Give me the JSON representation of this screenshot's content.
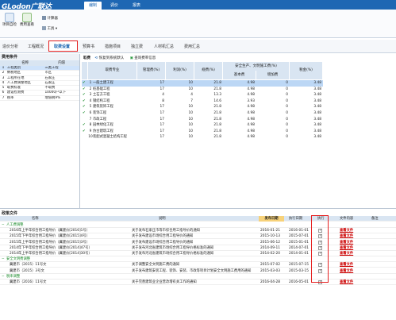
{
  "app": {
    "logo": "GLodon广联达",
    "top_tabs": [
      "编制",
      "调价",
      "报表"
    ],
    "active_top_tab": "编制"
  },
  "ribbon": {
    "buttons": [
      "项目自检",
      "费用查看"
    ],
    "calc_label": "计算器",
    "tools_label": "工具"
  },
  "nav_tabs": [
    "造价分析",
    "工程概况",
    "取费设置",
    "预算书",
    "措施项目",
    "独立费",
    "人材机汇总",
    "费用汇总"
  ],
  "active_nav_tab": "取费设置",
  "left_panel": {
    "title": "费用条件",
    "headers": [
      "名称",
      "内容"
    ],
    "rows": [
      {
        "num": "1",
        "name": "工程类别",
        "value": "三类工程"
      },
      {
        "num": "2",
        "name": "纳税地区",
        "value": "市区"
      },
      {
        "num": "3",
        "name": "工程所在地",
        "value": "石家庄"
      },
      {
        "num": "4",
        "name": "人工费调整地区",
        "value": "石家庄"
      },
      {
        "num": "5",
        "name": "取费标准",
        "value": "不取费"
      },
      {
        "num": "6",
        "name": "建设检测费",
        "value": "10000户以下"
      },
      {
        "num": "7",
        "name": "税率",
        "value": "增值税9%"
      }
    ]
  },
  "main": {
    "toolbar": [
      "取费",
      "恢复到系统默认",
      "查询费率信息"
    ],
    "headers": {
      "col_major": "取费专业",
      "col_mgmt": "管理费(%)",
      "col_profit": "利润(%)",
      "col_fee": "规费(%)",
      "col_safety": "安全生产、文明施工费(%)",
      "col_safety_base": "基本费",
      "col_safety_add": "增加费",
      "col_tax": "税金(%)"
    },
    "rows": [
      {
        "num": "1",
        "name": "一般土建工程",
        "mgmt": "17",
        "profit": "10",
        "fee": "21.8",
        "base": "4.98",
        "add": "0",
        "tax": "3.48",
        "checked": true
      },
      {
        "num": "2",
        "name": "桩基础工程",
        "mgmt": "17",
        "profit": "10",
        "fee": "21.8",
        "base": "4.98",
        "add": "0",
        "tax": "3.48",
        "checked": true
      },
      {
        "num": "3",
        "name": "土石方工程",
        "mgmt": "4",
        "profit": "4",
        "fee": "13.3",
        "base": "4.98",
        "add": "0",
        "tax": "3.48",
        "checked": true
      },
      {
        "num": "4",
        "name": "钢结构工程",
        "mgmt": "8",
        "profit": "7",
        "fee": "14.6",
        "base": "3.93",
        "add": "0",
        "tax": "3.48",
        "checked": true
      },
      {
        "num": "5",
        "name": "建筑装饰工程",
        "mgmt": "17",
        "profit": "10",
        "fee": "21.8",
        "base": "4.98",
        "add": "0",
        "tax": "3.48",
        "checked": true
      },
      {
        "num": "6",
        "name": "装饰工程",
        "mgmt": "17",
        "profit": "10",
        "fee": "21.8",
        "base": "4.98",
        "add": "0",
        "tax": "3.48",
        "checked": true
      },
      {
        "num": "7",
        "name": "市政工程",
        "mgmt": "17",
        "profit": "10",
        "fee": "21.8",
        "base": "4.98",
        "add": "0",
        "tax": "3.48",
        "checked": false
      },
      {
        "num": "8",
        "name": "园林绿化工程",
        "mgmt": "17",
        "profit": "10",
        "fee": "21.8",
        "base": "4.98",
        "add": "0",
        "tax": "3.48",
        "checked": true
      },
      {
        "num": "9",
        "name": "仿古建筑工程",
        "mgmt": "17",
        "profit": "10",
        "fee": "21.8",
        "base": "4.98",
        "add": "0",
        "tax": "3.48",
        "checked": true
      },
      {
        "num": "10",
        "name": "装配式混凝土结构工程",
        "mgmt": "17",
        "profit": "10",
        "fee": "21.8",
        "base": "4.98",
        "add": "0",
        "tax": "3.48",
        "checked": false
      }
    ]
  },
  "bottom": {
    "title": "政策文件",
    "headers": {
      "col_name": "名称",
      "col_desc": "说明",
      "col_date": "发布日期",
      "col_exec": "执行日期",
      "col_apply": "执行",
      "col_file": "文件内容",
      "col_note": "备注"
    },
    "rows": [
      {
        "type": "group",
        "name": "人工费调整"
      },
      {
        "type": "item",
        "name": "2016年上半年综合用工指导价（冀建价[2016]1号）",
        "desc": "关于发布石家庄市等市综合用工指导价的通知",
        "date": "2016-01-21",
        "exec": "2016-01-01",
        "checked": true,
        "link": "查看文件"
      },
      {
        "type": "item",
        "name": "2015年下半年综合用工指导价（冀建价[2015]4号）",
        "desc": "关于发布建设市场综合用工指导价的通知",
        "date": "2015-10-13",
        "exec": "2015-07-01",
        "checked": true,
        "link": "查看文件"
      },
      {
        "type": "item",
        "name": "2015年上半年综合用工指导价（冀建价[2015]3号）",
        "desc": "关于发布建设市场综合用工指导价的通知",
        "date": "2015-06-12",
        "exec": "2015-01-01",
        "checked": true,
        "link": "查看文件"
      },
      {
        "type": "item",
        "name": "2014年下半年综合用工指导价（冀建价[2014]47号）",
        "desc": "关于发布河北省建筑市场综合用工指导价格标准的通知",
        "date": "2014-09-11",
        "exec": "2014-07-01",
        "checked": true,
        "link": "查看文件"
      },
      {
        "type": "item",
        "name": "2014年上半年综合用工指导价（冀建价[2014]30号）",
        "desc": "关于发布河北省建筑市场综合用工指导价格标准的通知",
        "date": "2014-02-20",
        "exec": "2014-01-01",
        "checked": true,
        "link": "查看文件"
      },
      {
        "type": "group",
        "name": "安全文明费调整"
      },
      {
        "type": "item",
        "name": "冀建市（2015）11号文",
        "desc": "关于调整安全文明施工费的通知",
        "date": "2015-07-02",
        "exec": "2015-07-15",
        "checked": true,
        "link": "查看文件"
      },
      {
        "type": "item",
        "name": "冀建市（2015）3号文",
        "desc": "关于发布建筑安装工程、装饰、安装、市政等项目计划安全文明施工费用的通知",
        "date": "2015-03-03",
        "exec": "2015-03-15",
        "checked": true,
        "link": "查看文件"
      },
      {
        "type": "group",
        "name": "税率调整"
      },
      {
        "type": "item",
        "name": "冀建市（2016）11号文",
        "desc": "关于完善建筑业企业营改增有关工作的通知",
        "date": "2016-04-28",
        "exec": "2016-05-01",
        "checked": true,
        "link": "查看文件"
      }
    ]
  },
  "colors": {
    "brand": "#1e67b3",
    "highlight": "#e52020",
    "group_text": "#1a8a2a",
    "link": "#c00000"
  }
}
